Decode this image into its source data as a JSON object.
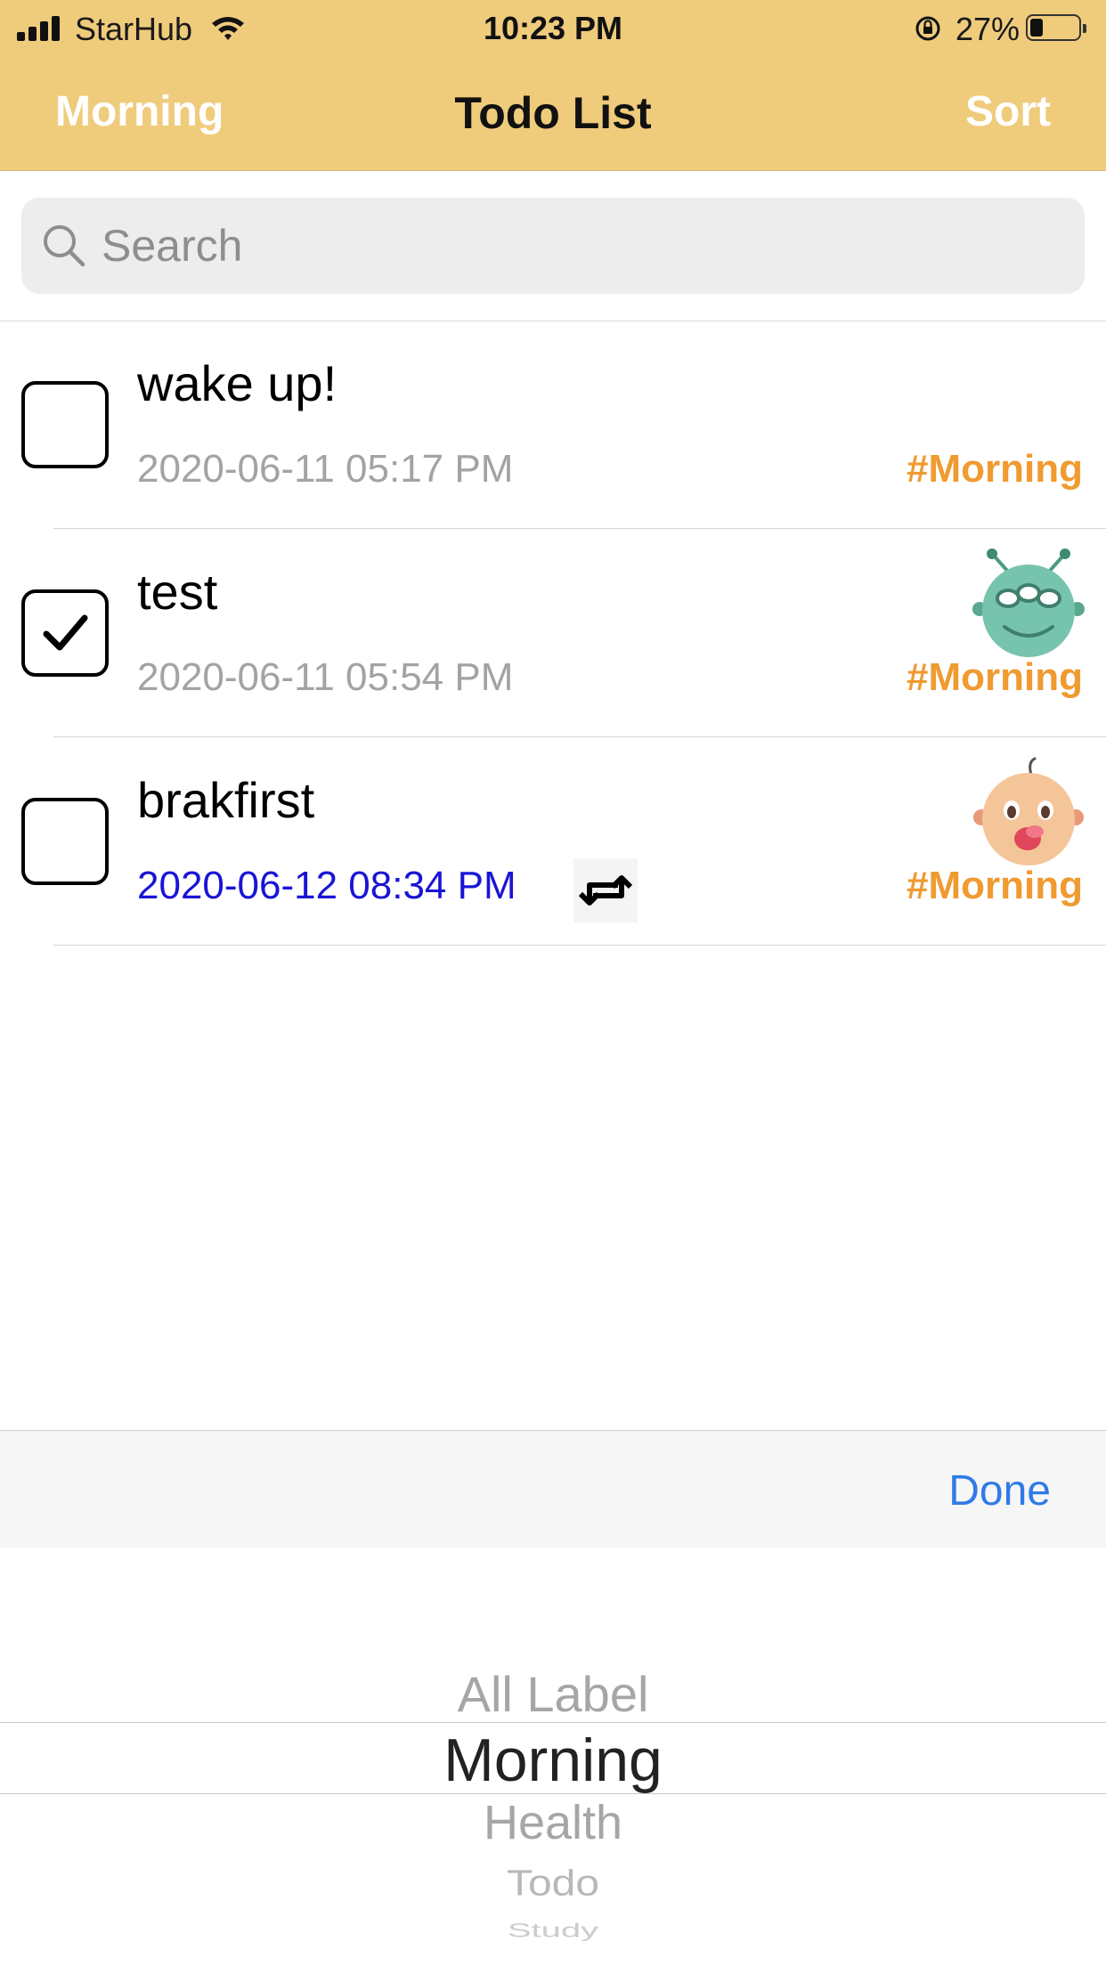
{
  "status_bar": {
    "carrier": "StarHub",
    "time": "10:23 PM",
    "battery": "27%"
  },
  "nav": {
    "left_label": "Morning",
    "title": "Todo List",
    "right_label": "Sort"
  },
  "search": {
    "placeholder": "Search"
  },
  "todos": [
    {
      "title": "wake up!",
      "date": "2020-06-11 05:17 PM",
      "tag": "#Morning",
      "checked": false
    },
    {
      "title": "test",
      "date": "2020-06-11 05:54 PM",
      "tag": "#Morning",
      "checked": true,
      "avatar": "green-alien-avatar"
    },
    {
      "title": "brakfirst",
      "date": "2020-06-12 08:34 PM",
      "tag": "#Morning",
      "checked": false,
      "avatar": "baby-face-avatar",
      "repeat": true
    }
  ],
  "picker": {
    "done_label": "Done",
    "options": [
      "All Label",
      "Morning",
      "Health",
      "Todo",
      "Study"
    ],
    "selected": "Morning"
  },
  "colors": {
    "header": "#efcb7c",
    "tag": "#f09a30",
    "due_date_highlight": "#1a14d6",
    "done": "#2f7be6"
  }
}
